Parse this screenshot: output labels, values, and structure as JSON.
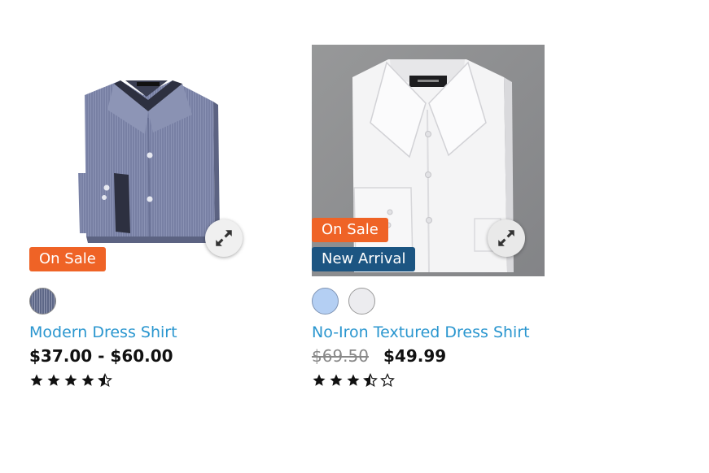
{
  "products": [
    {
      "name": "Modern Dress Shirt",
      "price": "$37.00 - $60.00",
      "badges": [
        "On Sale"
      ],
      "swatches": [
        "navy-pinstripe"
      ],
      "rating": 4.5,
      "image": "blue-gray dress shirt folded"
    },
    {
      "name": "No-Iron Textured Dress Shirt",
      "price_original": "$69.50",
      "price": "$49.99",
      "badges": [
        "On Sale",
        "New Arrival"
      ],
      "swatches": [
        "light-blue",
        "white"
      ],
      "rating": 3.5,
      "image": "white dress shirt folded"
    }
  ],
  "colors": {
    "sale_badge": "#ef6326",
    "new_badge": "#1c5582",
    "link": "#2a96cf"
  },
  "icons": {
    "zoom": "expand-arrows-icon",
    "star_full": "star-filled-icon",
    "star_half": "star-half-icon",
    "star_empty": "star-empty-icon"
  }
}
